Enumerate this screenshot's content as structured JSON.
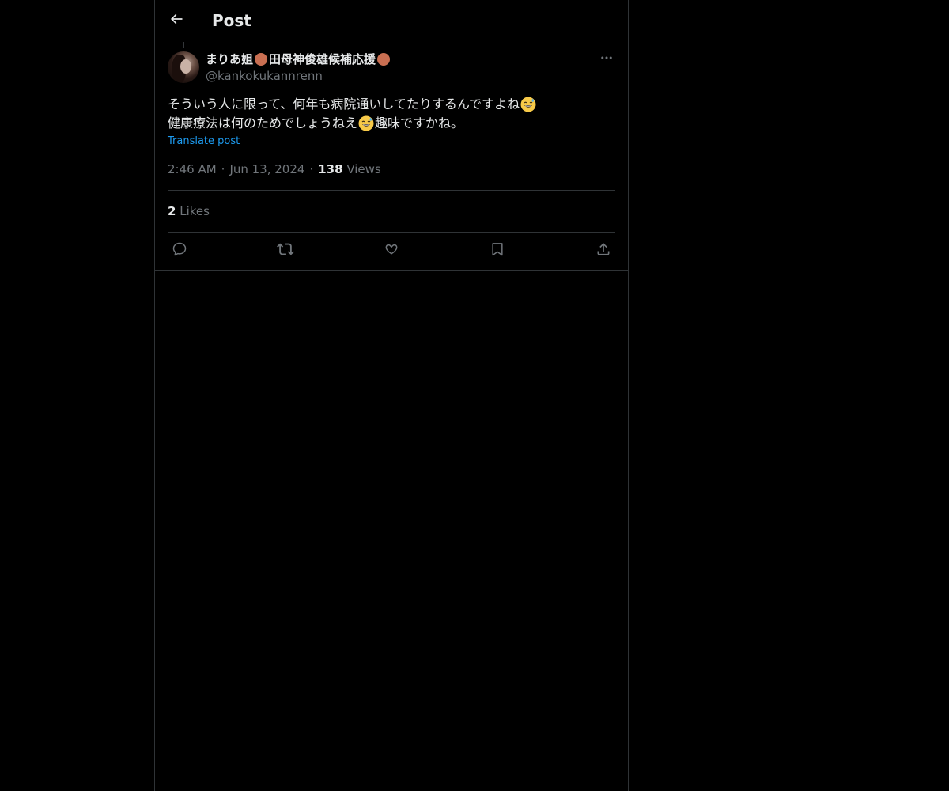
{
  "header": {
    "title": "Post",
    "back_icon": "arrow-left-icon"
  },
  "post": {
    "author": {
      "name_parts": [
        "まりあ姐",
        "田母神俊雄候補応援"
      ],
      "name_dot_color": "#c96f52",
      "handle": "@kankokukannrenn"
    },
    "text_lines": [
      {
        "before": "そういう人に限って、何年も病院通いしてたりするんですよね",
        "after": ""
      },
      {
        "before": "健康療法は何のためでしょうねえ",
        "after": "趣味ですかね。"
      }
    ],
    "emoji": "grinning-face-with-sweat",
    "translate_label": "Translate post",
    "time": "2:46 AM",
    "date": "Jun 13, 2024",
    "views_count": "138",
    "views_label": "Views",
    "likes_count": "2",
    "likes_label": "Likes"
  },
  "actions": [
    {
      "name": "reply-icon"
    },
    {
      "name": "repost-icon"
    },
    {
      "name": "like-icon"
    },
    {
      "name": "bookmark-icon"
    },
    {
      "name": "share-icon"
    }
  ],
  "colors": {
    "background": "#000000",
    "text": "#e7e9ea",
    "secondary": "#71767b",
    "link": "#1d9bf0",
    "border": "#2f3336"
  }
}
